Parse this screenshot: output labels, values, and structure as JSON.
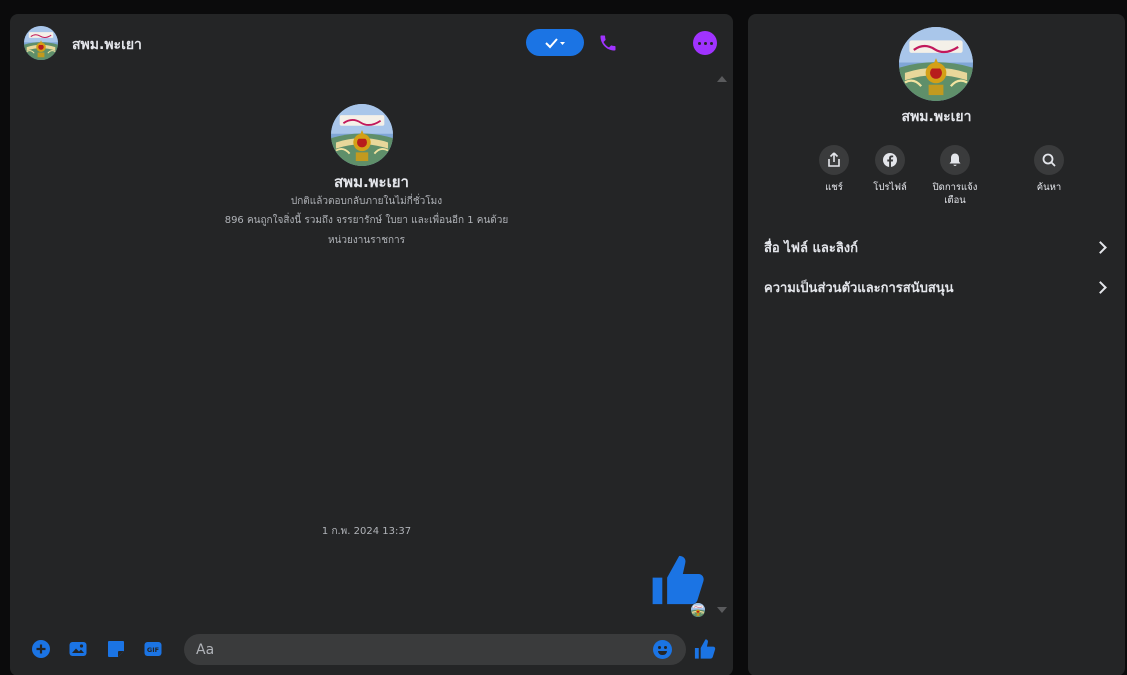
{
  "chat": {
    "name": "สพม.พะเยา",
    "intro": {
      "name": "สพม.พะเยา",
      "response_note": "ปกติแล้วตอบกลับภายในไม่กี่ชั่วโมง",
      "likes_note": "896 คนถูกใจสิ่งนี้ รวมถึง จรรยารักษ์ ใบยา และเพื่อนอีก 1 คนด้วย",
      "category": "หน่วยงานราชการ"
    },
    "timestamp": "1 ก.พ. 2024 13:37",
    "composer": {
      "placeholder": "Aa",
      "gif_label": "GIF"
    }
  },
  "sidebar": {
    "name": "สพม.พะเยา",
    "actions": [
      {
        "label": "แชร์",
        "icon": "share-icon"
      },
      {
        "label": "โปรไฟล์",
        "icon": "facebook-icon"
      },
      {
        "label": "ปิดการแจ้งเตือน",
        "icon": "bell-icon"
      },
      {
        "label": "ค้นหา",
        "icon": "search-icon"
      }
    ],
    "rows": [
      {
        "label": "สื่อ ไฟล์ และลิงก์"
      },
      {
        "label": "ความเป็นส่วนตัวและการสนับสนุน"
      }
    ]
  },
  "colors": {
    "background": "#0b0b0c",
    "panel": "#242526",
    "accent_blue": "#1b74e4",
    "accent_purple": "#a033ff",
    "text_primary": "#e4e6eb",
    "text_secondary": "#b0b3b8"
  }
}
